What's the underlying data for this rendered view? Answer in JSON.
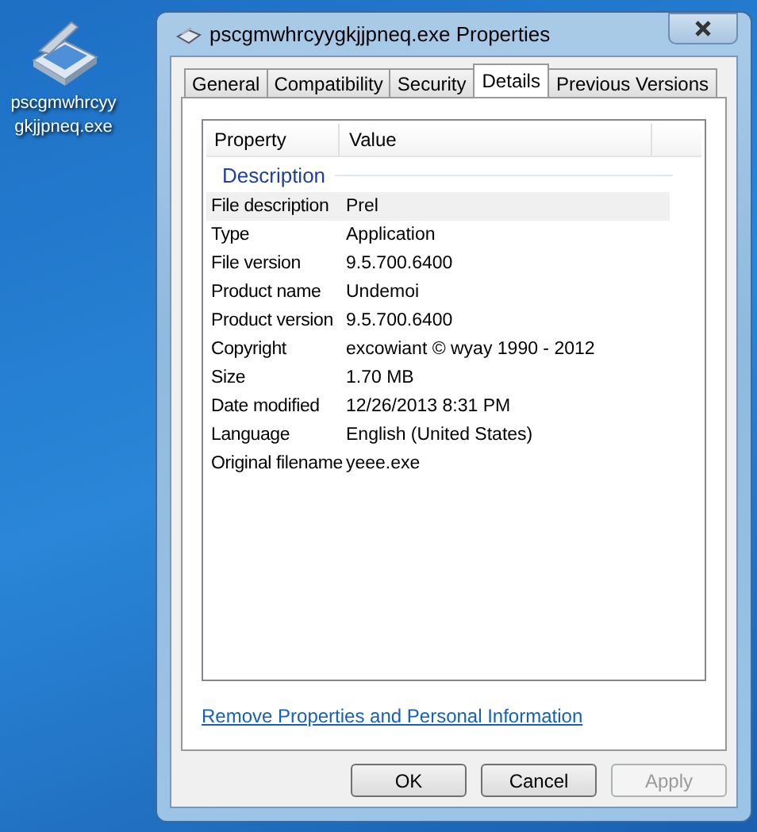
{
  "desktop_icon": {
    "label": "pscgmwhrcyygkjjpneq.exe"
  },
  "window": {
    "title": "pscgmwhrcyygkjjpneq.exe Properties"
  },
  "tabs": [
    {
      "label": "General",
      "selected": false
    },
    {
      "label": "Compatibility",
      "selected": false
    },
    {
      "label": "Security",
      "selected": false
    },
    {
      "label": "Details",
      "selected": true
    },
    {
      "label": "Previous Versions",
      "selected": false
    }
  ],
  "table": {
    "columns": [
      "Property",
      "Value"
    ],
    "group": "Description",
    "rows": [
      {
        "property": "File description",
        "value": "Prel",
        "selected": true
      },
      {
        "property": "Type",
        "value": "Application",
        "selected": false
      },
      {
        "property": "File version",
        "value": "9.5.700.6400",
        "selected": false
      },
      {
        "property": "Product name",
        "value": "Undemoi",
        "selected": false
      },
      {
        "property": "Product version",
        "value": "9.5.700.6400",
        "selected": false
      },
      {
        "property": "Copyright",
        "value": "excowiant © wyay 1990 - 2012",
        "selected": false
      },
      {
        "property": "Size",
        "value": "1.70 MB",
        "selected": false
      },
      {
        "property": "Date modified",
        "value": "12/26/2013 8:31 PM",
        "selected": false
      },
      {
        "property": "Language",
        "value": "English (United States)",
        "selected": false
      },
      {
        "property": "Original filename",
        "value": "yeee.exe",
        "selected": false
      }
    ]
  },
  "link": "Remove Properties and Personal Information",
  "buttons": [
    {
      "label": "OK",
      "disabled": false
    },
    {
      "label": "Cancel",
      "disabled": false
    },
    {
      "label": "Apply",
      "disabled": true
    }
  ]
}
